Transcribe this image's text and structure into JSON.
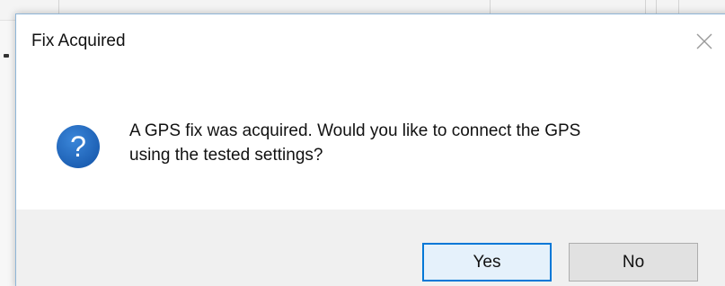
{
  "dialog": {
    "title": "Fix Acquired",
    "message_line1": "A GPS fix was acquired. Would you like to connect the GPS",
    "message_line2": "using the tested settings?",
    "icon": "question-icon",
    "close_icon": "close-icon",
    "buttons": {
      "yes": "Yes",
      "no": "No"
    },
    "default_button": "yes"
  },
  "colors": {
    "icon_blue": "#1f64b8",
    "default_button_border": "#0078d7",
    "footer_background": "#f0f0f0"
  }
}
